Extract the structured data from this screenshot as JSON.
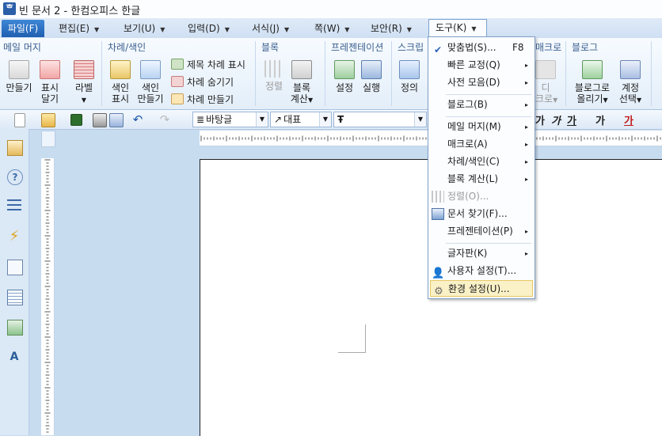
{
  "window": {
    "title": "빈 문서 2 - 한컴오피스 한글",
    "icon": "hangul-app-icon"
  },
  "menubar": {
    "items": [
      {
        "label": "파일(F)"
      },
      {
        "label": "편집(E)"
      },
      {
        "label": "보기(U)"
      },
      {
        "label": "입력(D)"
      },
      {
        "label": "서식(J)"
      },
      {
        "label": "쪽(W)"
      },
      {
        "label": "보안(R)"
      },
      {
        "label": "도구(K)"
      }
    ]
  },
  "ribbon": {
    "groups": {
      "mailmerge": {
        "title": "메일 머지",
        "make": "만들기",
        "show1": "표시",
        "show2": "달기",
        "label": "라벨"
      },
      "toc": {
        "title": "차례/색인",
        "index_show1": "색인",
        "index_show2": "표시",
        "index_make1": "색인",
        "index_make2": "만들기",
        "title_show": "제목 차례 표시",
        "toc_hide": "차례 숨기기",
        "toc_make": "차례 만들기"
      },
      "block": {
        "title": "블록",
        "sort": "정렬",
        "calc1": "블록",
        "calc2": "계산"
      },
      "presentation": {
        "title": "프레젠테이션",
        "setup": "설정",
        "run": "실행"
      },
      "script": {
        "title": "스크립",
        "define": "정의"
      },
      "macro": {
        "title": "매크로",
        "m1": "디",
        "m2": "크로"
      },
      "blog": {
        "title": "블로그",
        "post1": "블로그로",
        "post2": "올리기",
        "account1": "계정",
        "account2": "선택"
      }
    }
  },
  "toolbar": {
    "style": "바탕글",
    "font_lang": "대표",
    "font": "",
    "fmt": [
      "가",
      "가",
      "가",
      "가",
      "가"
    ]
  },
  "tools_menu": {
    "items": [
      {
        "label": "맞춤법(S)...",
        "shortcut": "F8"
      },
      {
        "label": "빠른 교정(Q)",
        "arrow": "▸"
      },
      {
        "label": "사전 모음(D)",
        "arrow": "▸"
      },
      {
        "label": "블로그(B)",
        "arrow": "▸"
      },
      {
        "label": "메일 머지(M)",
        "arrow": "▸"
      },
      {
        "label": "매크로(A)",
        "arrow": "▸"
      },
      {
        "label": "차례/색인(C)",
        "arrow": "▸"
      },
      {
        "label": "블록 계산(L)",
        "arrow": "▸"
      },
      {
        "label": "정렬(O)..."
      },
      {
        "label": "문서 찾기(F)..."
      },
      {
        "label": "프레젠테이션(P)",
        "arrow": "▸"
      },
      {
        "label": "글자판(K)",
        "arrow": "▸"
      },
      {
        "label": "사용자 설정(T)..."
      },
      {
        "label": "환경 설정(U)..."
      }
    ]
  },
  "colors": {
    "accent": "#1f5fb0",
    "menu_highlight": "#fbf1c7",
    "ribbon_group_title": "#3a5f8f"
  }
}
